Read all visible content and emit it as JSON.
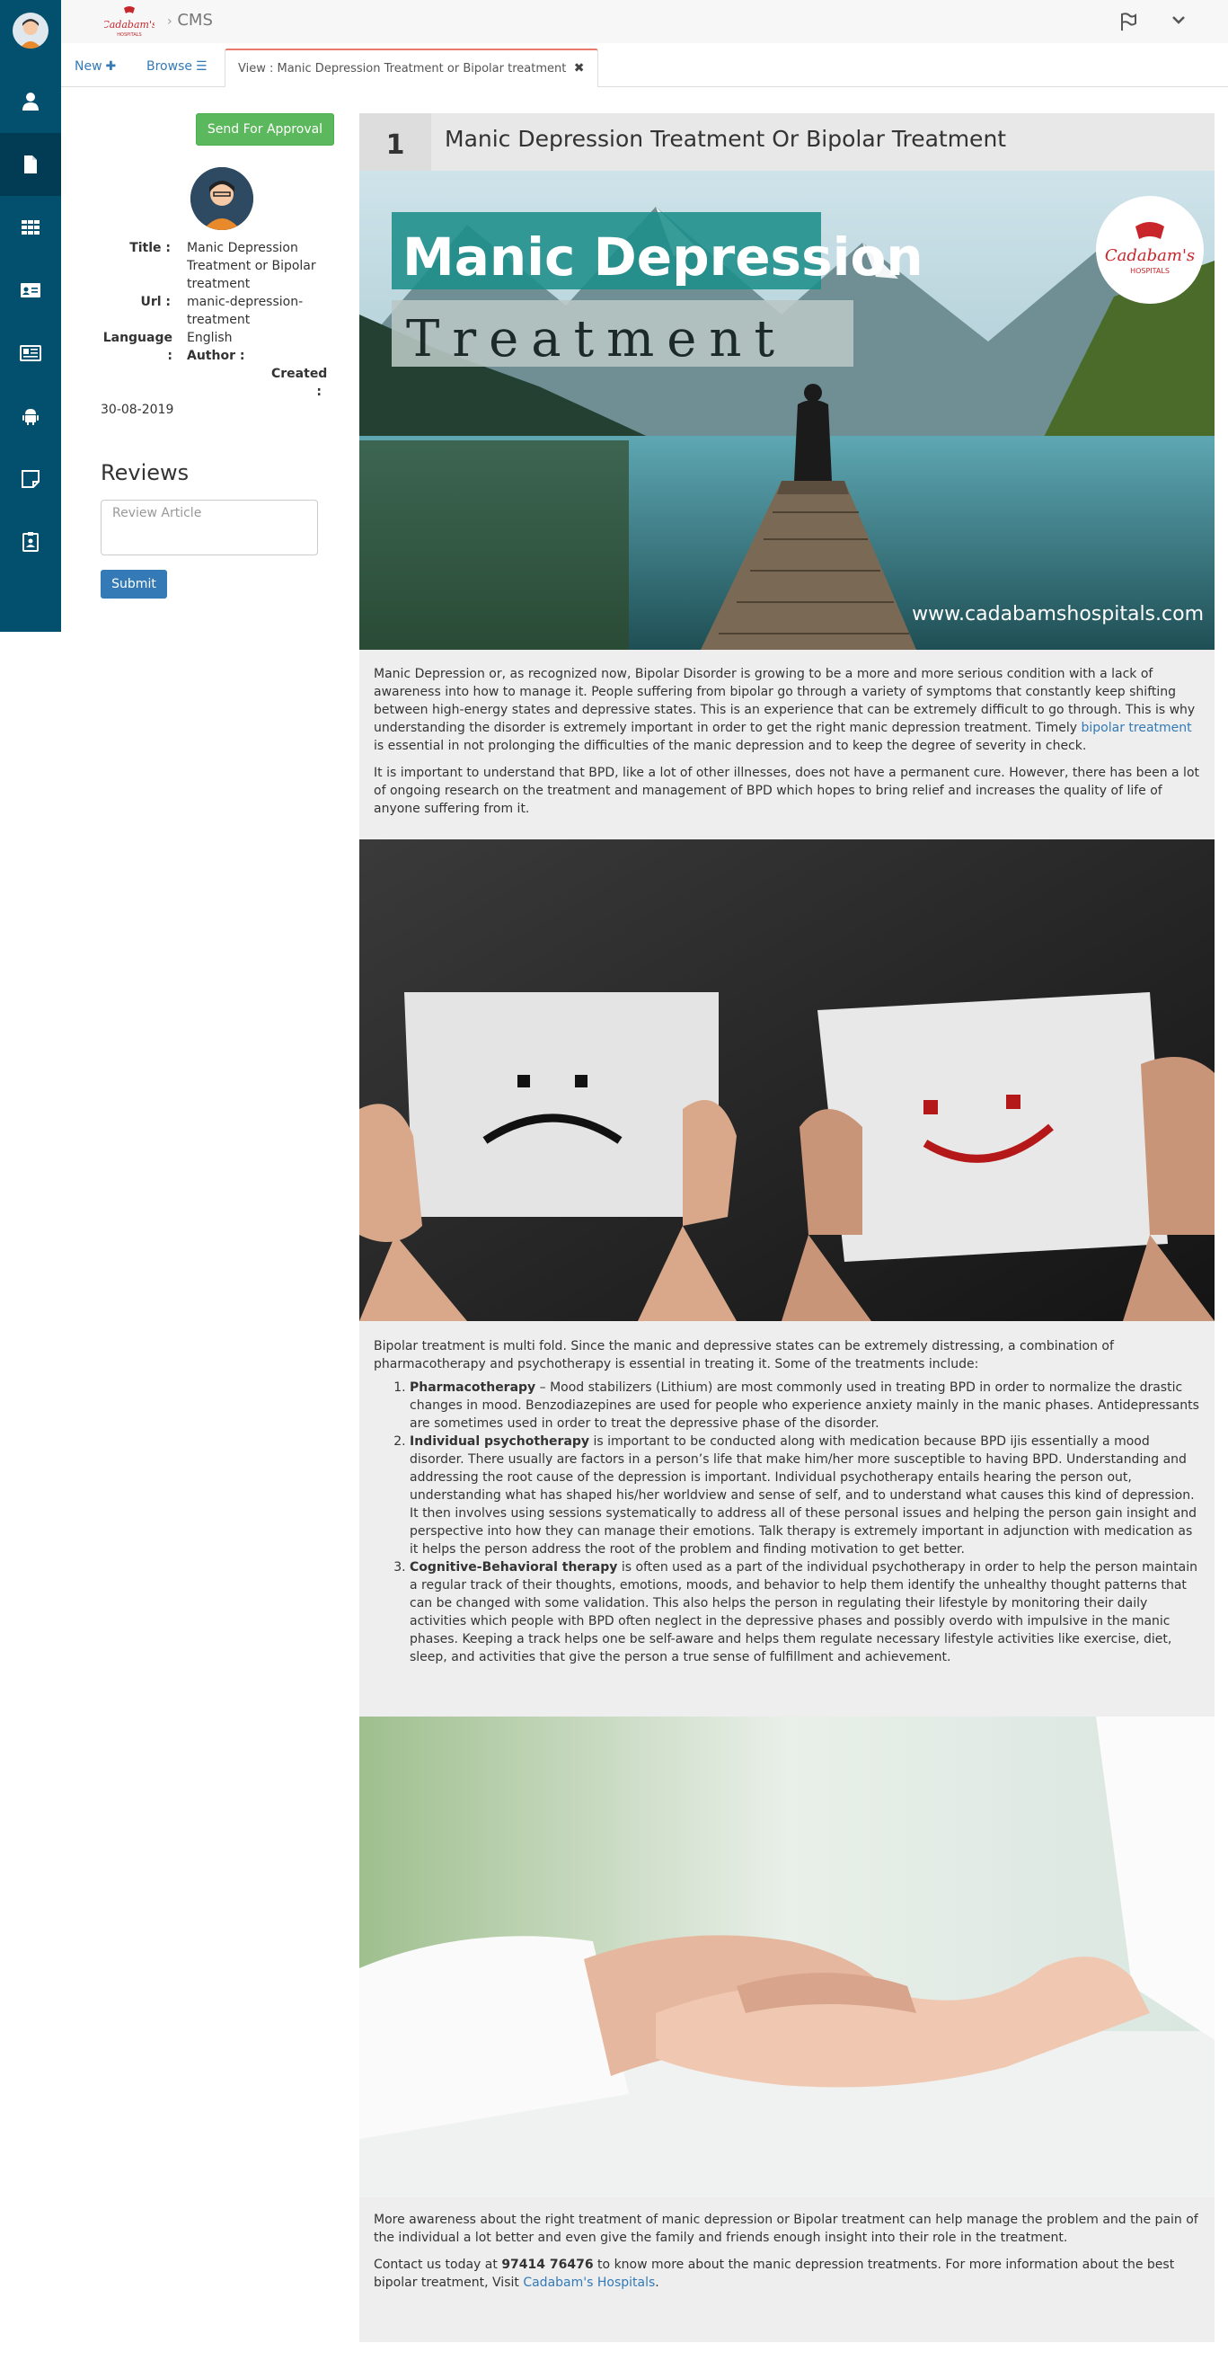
{
  "header": {
    "logo_text": "Cadabam's",
    "logo_subtext": "HOSPITALS",
    "breadcrumb": "CMS"
  },
  "tabs": {
    "new_label": "New",
    "browse_label": "Browse",
    "view_label": "View : Manic Depression Treatment or Bipolar treatment"
  },
  "left": {
    "approve_label": "Send For Approval",
    "title_label": "Title :",
    "title_value": "Manic Depression Treatment or Bipolar treatment",
    "url_label": "Url :",
    "url_value": "manic-depression-treatment",
    "language_label": "Language :",
    "language_value": "English",
    "author_label": "Author :",
    "author_value": "",
    "created_label": "Created :",
    "created_value": "30-08-2019",
    "reviews_title": "Reviews",
    "review_placeholder": "Review Article",
    "submit_label": "Submit"
  },
  "article": {
    "number": "1",
    "title": "Manic Depression Treatment Or Bipolar Treatment",
    "banner": {
      "line1": "Manic Depression",
      "line2": "Treatment",
      "logo_text": "Cadabam's",
      "logo_sub": "HOSPITALS",
      "url": "www.cadabamshospitals.com"
    },
    "p1_a": "Manic Depression or, as recognized now, Bipolar Disorder is growing to be a more and more serious condition with a lack of awareness into how to manage it. People suffering from bipolar go through a variety of symptoms that constantly keep shifting between high-energy states and depressive states. This is an experience that can be extremely difficult to go through. This is why understanding the disorder is extremely important in order to get the right manic depression treatment. Timely ",
    "p1_link": "bipolar treatment",
    "p1_b": " is essential in not prolonging the difficulties of the manic depression and to keep the degree of severity in check.",
    "p2": "It is important to understand that BPD, like a lot of other illnesses, does not have a permanent cure. However, there has been a lot of ongoing research on the treatment and management of BPD which hopes to bring relief and increases the quality of life of anyone suffering from it.",
    "p3": "Bipolar treatment is multi fold. Since the manic and depressive states can be extremely distressing, a combination of pharmacotherapy and psychotherapy is essential in treating it. Some of the treatments include:",
    "treatments": [
      {
        "name": "Pharmacotherapy",
        "text": " – Mood stabilizers (Lithium) are most commonly used in treating BPD in order to normalize the drastic changes in mood. Benzodiazepines are used for people who experience anxiety mainly in the manic phases. Antidepressants are sometimes used in order to treat the depressive phase of the disorder."
      },
      {
        "name": "Individual psychotherapy",
        "text": " is important to be conducted along with medication because BPD ijis essentially a mood disorder. There usually are factors in a person’s life that make him/her more susceptible to having BPD. Understanding and addressing the root cause of the depression is important. Individual psychotherapy entails hearing the person out, understanding what has shaped his/her worldview and sense of self, and to understand what causes this kind of depression. It then involves using sessions systematically to address all of these personal issues and helping the person gain insight and perspective into how they can manage their emotions. Talk therapy is extremely important in adjunction with medication as it helps the person address the root of the problem and finding motivation to get better."
      },
      {
        "name": "Cognitive-Behavioral therapy",
        "text": " is often used as a part of the individual psychotherapy in order to help the person maintain a regular track of their thoughts, emotions, moods, and behavior to help them identify the unhealthy thought patterns that can be changed with some validation. This also helps the person in regulating their lifestyle by monitoring their daily activities which people with BPD often neglect in the depressive phases and possibly overdo with impulsive in the manic phases. Keeping a track helps one be self-aware and helps them regulate necessary lifestyle activities like exercise, diet, sleep, and activities that give the person a true sense of fulfillment and achievement."
      }
    ],
    "p4": "More awareness about the right treatment of manic depression or Bipolar treatment can help manage the problem and the pain of the individual a lot better and even give the family and friends enough insight into their role in the treatment.",
    "p5_a": "Contact us today at ",
    "p5_phone": "97414 76476",
    "p5_b": " to know more about the manic depression treatments. For more information about the best bipolar treatment, Visit ",
    "p5_link": "Cadabam's Hospitals",
    "p5_c": "."
  },
  "colors": {
    "sidebar": "#02506e",
    "approve": "#5cb85c",
    "primary": "#337ab7",
    "tab_accent": "#e87a6b"
  },
  "icons": [
    "user-icon",
    "file-icon",
    "grid-icon",
    "id-card-icon",
    "newspaper-icon",
    "android-icon",
    "sticky-note-icon",
    "badge-icon",
    "flag-icon",
    "chevron-down-icon",
    "plus-icon",
    "list-icon",
    "close-icon"
  ]
}
